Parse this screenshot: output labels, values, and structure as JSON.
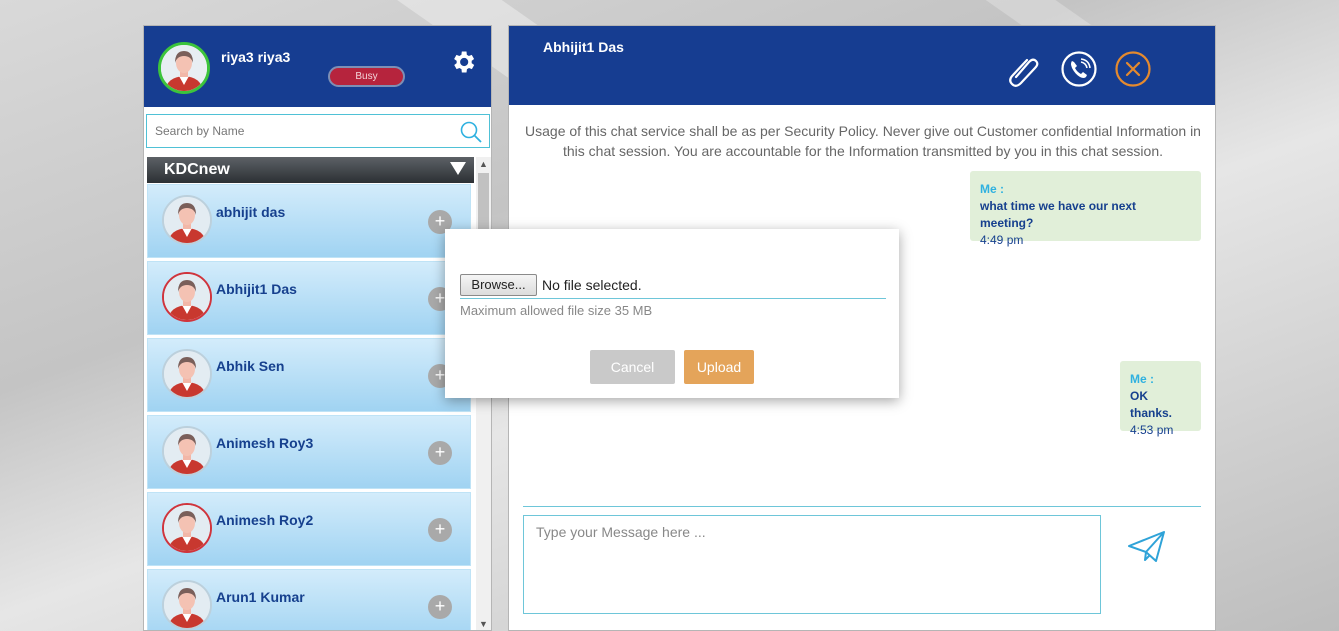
{
  "user": {
    "name": "riya3 riya3",
    "status": "Busy",
    "status_color": "#b6243d",
    "presence_color": "#3cc43c"
  },
  "search": {
    "placeholder": "Search by Name"
  },
  "group": {
    "name": "KDCnew"
  },
  "contacts": [
    {
      "name": "abhijit das",
      "ring": "grey"
    },
    {
      "name": "Abhijit1 Das",
      "ring": "red"
    },
    {
      "name": "Abhik Sen",
      "ring": "grey"
    },
    {
      "name": "Animesh Roy3",
      "ring": "grey"
    },
    {
      "name": "Animesh Roy2",
      "ring": "red"
    },
    {
      "name": "Arun1 Kumar",
      "ring": "grey"
    }
  ],
  "add_symbol": "+",
  "chat": {
    "title": "Abhijit1 Das",
    "policy_text": "Usage of this chat service shall be as per Security Policy. Never give out Customer confidential Information in this chat session. You are accountable for the Information transmitted by you in this chat session.",
    "messages": [
      {
        "sender": "Me :",
        "text": "what time we have our next meeting?",
        "time": "4:49 pm"
      },
      {
        "sender": "Me :",
        "text": "OK thanks.",
        "time": "4:53 pm"
      }
    ],
    "input_placeholder": "Type your Message here ..."
  },
  "upload_dialog": {
    "browse_label": "Browse...",
    "file_status": "No file selected.",
    "hint": "Maximum allowed file size 35 MB",
    "cancel_label": "Cancel",
    "upload_label": "Upload"
  },
  "colors": {
    "header_blue": "#163d91",
    "accent_cyan": "#6ec6d9",
    "close_orange": "#e58a2e",
    "upload_orange": "#e4a45a",
    "bubble_green": "#e1efd9"
  },
  "icons": {
    "settings": "gear-icon",
    "search": "search-icon",
    "attach": "paperclip-icon",
    "call": "phone-icon",
    "close": "close-icon",
    "send": "send-icon",
    "add": "plus-icon"
  },
  "scroll": {
    "up": "▲",
    "down": "▼"
  }
}
